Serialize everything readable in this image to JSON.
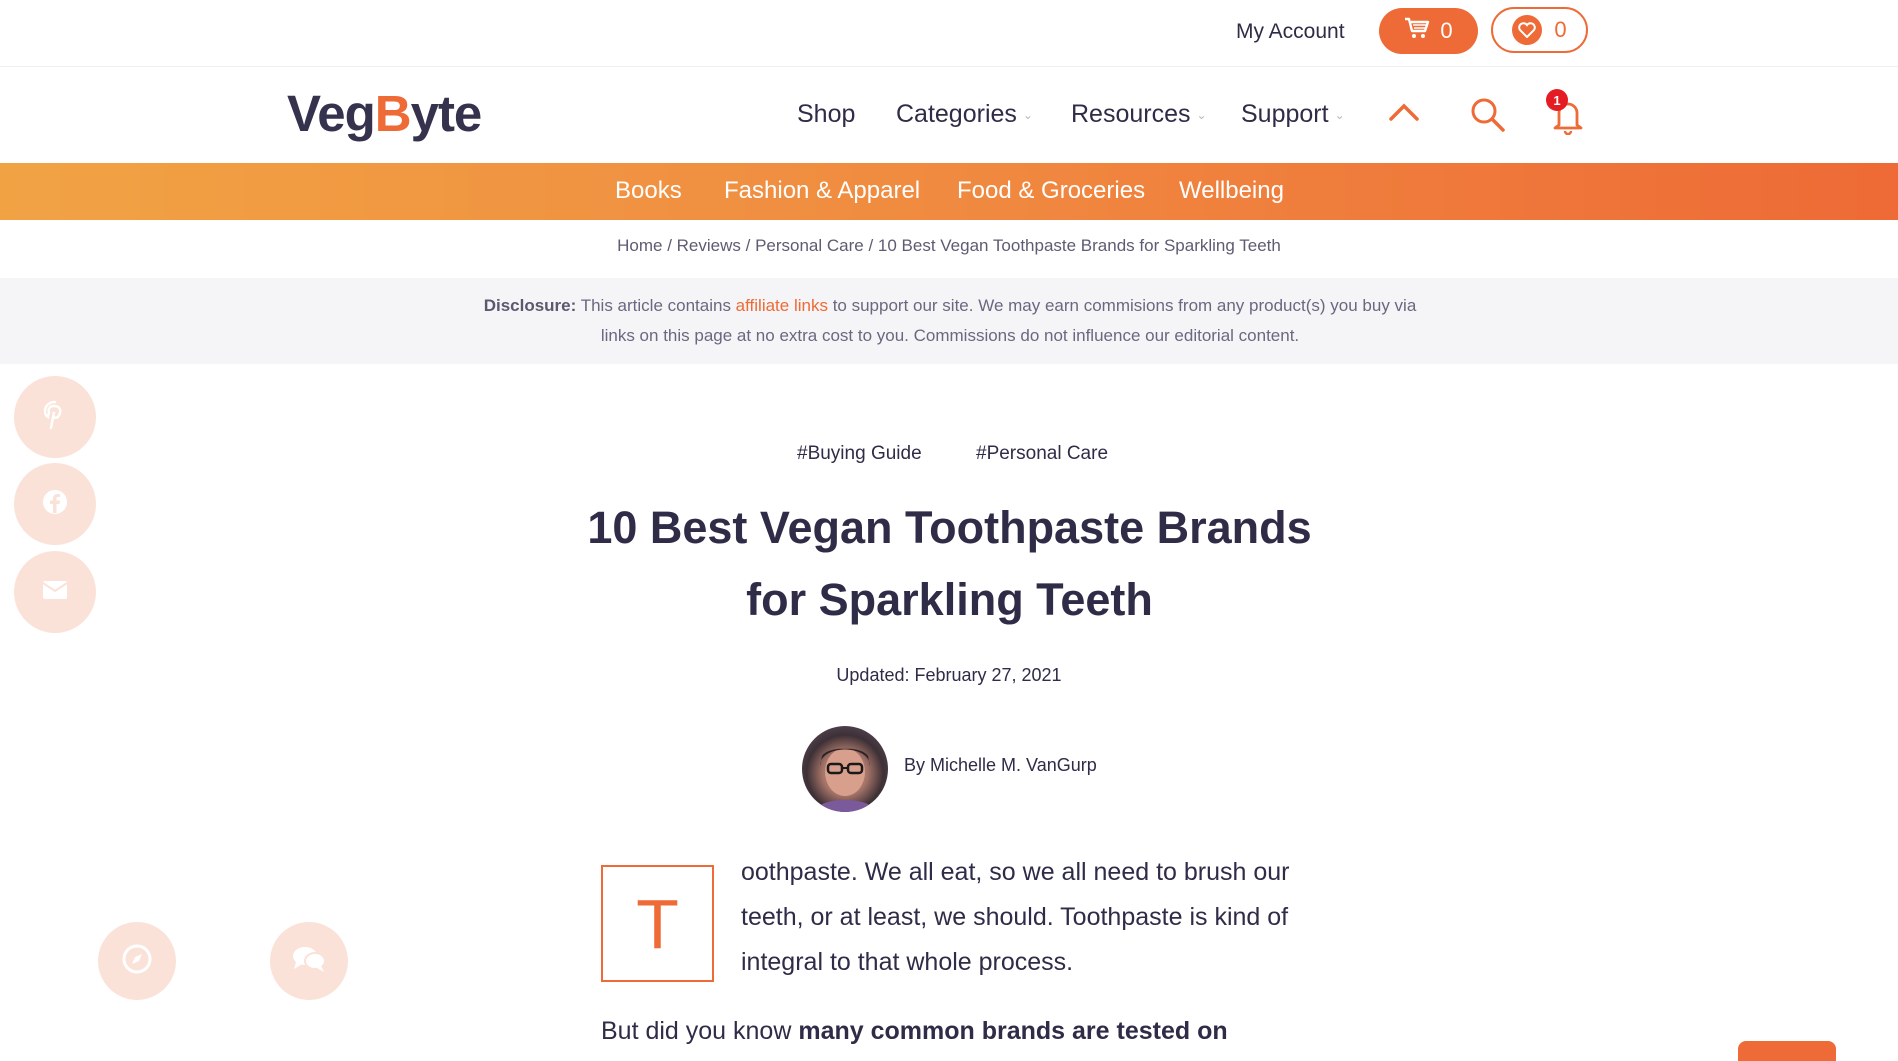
{
  "topbar": {
    "my_account": "My Account",
    "cart_count": "0",
    "wishlist_count": "0"
  },
  "header": {
    "logo_part1": "Veg",
    "logo_b": "B",
    "logo_part2": "yte",
    "nav": [
      "Shop",
      "Categories",
      "Resources",
      "Support"
    ],
    "notification_count": "1"
  },
  "category_bar": [
    "Books",
    "Fashion & Apparel",
    "Food & Groceries",
    "Wellbeing"
  ],
  "breadcrumb": "Home / Reviews / Personal Care / 10 Best Vegan Toothpaste Brands for Sparkling Teeth",
  "disclosure": {
    "label": "Disclosure:",
    "text_before": " This article contains ",
    "link": "affiliate links",
    "text_after": " to support our site. We may earn commisions from any product(s) you buy via links on this page at no extra cost to you. Commissions do not influence our editorial content."
  },
  "article": {
    "tags": [
      "#Buying Guide",
      "#Personal Care"
    ],
    "title": "10 Best Vegan Toothpaste Brands for Sparkling Teeth",
    "updated": "Updated: February 27, 2021",
    "author": "By Michelle M. VanGurp",
    "dropcap": "T",
    "intro": "oothpaste. We all eat, so we all need to brush our teeth, or at least, we should. Toothpaste is kind of integral to that whole process.",
    "para2_normal": "But did you know ",
    "para2_bold": "many common brands are tested on"
  },
  "icons": [
    "cart-icon",
    "heart-icon",
    "chevron-up-icon",
    "search-icon",
    "bell-icon",
    "pinterest-icon",
    "facebook-icon",
    "email-icon",
    "compass-icon",
    "chat-icon"
  ],
  "colors": {
    "accent": "#ee6a36",
    "text": "#2f2c47",
    "social_bg": "#fbe2d8"
  }
}
